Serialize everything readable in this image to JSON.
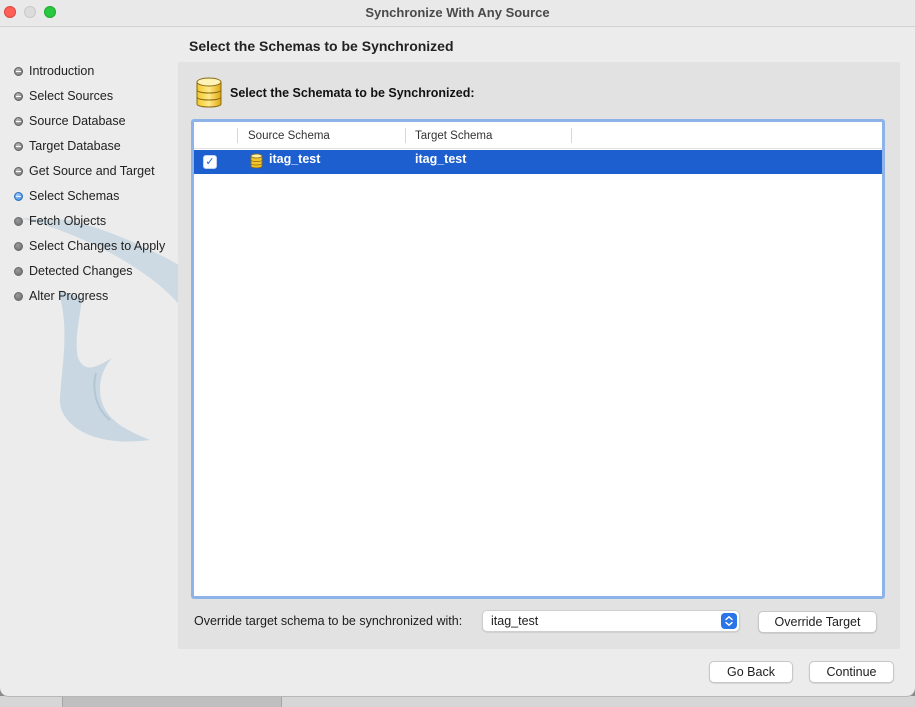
{
  "window": {
    "title": "Synchronize With Any Source"
  },
  "sidebar": {
    "steps": [
      {
        "label": "Introduction",
        "state": "done"
      },
      {
        "label": "Select Sources",
        "state": "done"
      },
      {
        "label": "Source Database",
        "state": "done"
      },
      {
        "label": "Target Database",
        "state": "done"
      },
      {
        "label": "Get Source and Target",
        "state": "done"
      },
      {
        "label": "Select Schemas",
        "state": "current"
      },
      {
        "label": "Fetch Objects",
        "state": "pending"
      },
      {
        "label": "Select Changes to Apply",
        "state": "pending"
      },
      {
        "label": "Detected Changes",
        "state": "pending"
      },
      {
        "label": "Alter Progress",
        "state": "pending"
      }
    ]
  },
  "main": {
    "page_title": "Select the Schemas to be Synchronized",
    "heading": "Select the Schemata to be Synchronized:",
    "table": {
      "columns": [
        "Source Schema",
        "Target Schema"
      ],
      "rows": [
        {
          "checked": true,
          "source": "itag_test",
          "target": "itag_test",
          "selected": true
        }
      ]
    },
    "override_label": "Override target schema to be synchronized with:",
    "override_select_value": "itag_test",
    "override_button": "Override Target"
  },
  "footer": {
    "back_button": "Go Back",
    "continue_button": "Continue"
  },
  "colors": {
    "selection": "#1e5fd0",
    "accent": "#2a76e8",
    "focus_ring": "#8db3e8"
  }
}
